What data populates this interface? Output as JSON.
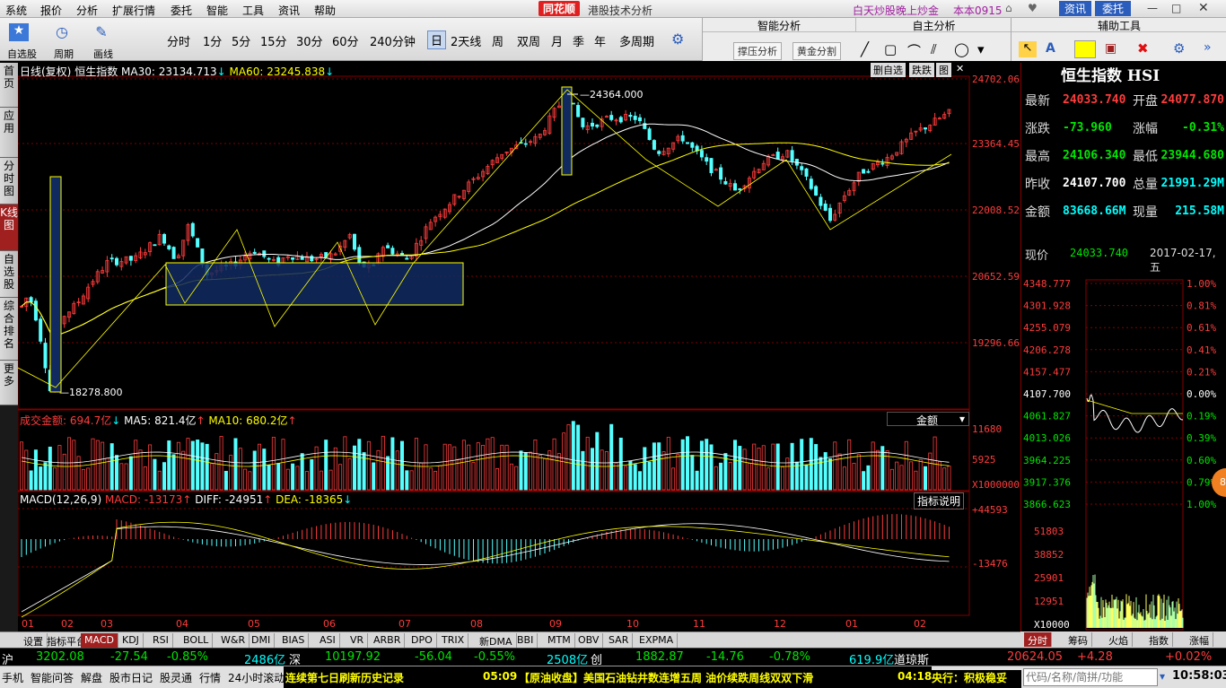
{
  "menu": [
    "系统",
    "报价",
    "分析",
    "扩展行情",
    "委托",
    "智能",
    "工具",
    "资讯",
    "帮助"
  ],
  "brand": "同花顺",
  "window_title": "港股技术分析",
  "ad_text": "白天炒股晚上炒金",
  "version": "本本0915",
  "news_btn": "资讯",
  "trade_btn": "委托",
  "toolbar": {
    "small_labels": [
      "自选股",
      "周期",
      "画线"
    ],
    "periods": [
      "分时",
      "1分",
      "5分",
      "15分",
      "30分",
      "60分",
      "240分钟",
      "日",
      "2天线",
      "周",
      "双周",
      "月",
      "季",
      "年",
      "多周期"
    ],
    "active_period": "日",
    "smart_title": "智能分析",
    "smart_btns": [
      "撑压分析",
      "黄金分割"
    ],
    "self_title": "自主分析",
    "aux_title": "辅助工具"
  },
  "sidebar_tabs": [
    "首页",
    "应用",
    "分时图",
    "K线图",
    "自选股",
    "综合排名",
    "更多"
  ],
  "main": {
    "header": {
      "type": "日线(复权)",
      "name": "恒生指数",
      "ma30": "MA30: 23134.713",
      "ma60": "MA60: 23245.838"
    },
    "top_btns": [
      "删自选",
      "跌跌",
      "图"
    ],
    "price_axis": [
      "24702.06",
      "23364.45",
      "22008.52",
      "20652.59",
      "19296.66"
    ],
    "high_label": "24364.000",
    "low_label": "18278.800",
    "vol_header": {
      "label": "成交金额: 694.7亿",
      "ma5": "MA5: 821.4亿",
      "ma10": "MA10: 680.2亿"
    },
    "vol_select": "金额",
    "vol_axis": [
      "11680",
      "5925",
      "X1000000"
    ],
    "macd_header": {
      "label": "MACD(12,26,9)",
      "macd": "MACD: -13173",
      "diff": "DIFF: -24951",
      "dea": "DEA: -18365"
    },
    "macd_btn": "指标说明",
    "macd_axis": [
      "+44593",
      "-13476"
    ],
    "months": [
      "01",
      "02",
      "03",
      "04",
      "05",
      "06",
      "07",
      "08",
      "09",
      "10",
      "11",
      "12",
      "01",
      "02"
    ]
  },
  "indicator_tabs": [
    "设置",
    "指标平台",
    "MACD",
    "KDJ",
    "RSI",
    "BOLL",
    "W&R",
    "DMI",
    "BIAS",
    "ASI",
    "VR",
    "ARBR",
    "DPO",
    "TRIX",
    "新DMA",
    "BBI",
    "MTM",
    "OBV",
    "SAR",
    "EXPMA"
  ],
  "active_indicator": "MACD",
  "quote": {
    "title": "恒生指数 HSI",
    "rows": [
      {
        "l1": "最新",
        "v1": "24033.740",
        "c1": "red",
        "l2": "开盘",
        "v2": "24077.870",
        "c2": "red"
      },
      {
        "l1": "涨跌",
        "v1": "-73.960",
        "c1": "green",
        "l2": "涨幅",
        "v2": "-0.31%",
        "c2": "green"
      },
      {
        "l1": "最高",
        "v1": "24106.340",
        "c1": "green",
        "l2": "最低",
        "v2": "23944.680",
        "c2": "green"
      },
      {
        "l1": "昨收",
        "v1": "24107.700",
        "c1": "white",
        "l2": "总量",
        "v2": "21991.29M",
        "c2": "cyan"
      },
      {
        "l1": "金额",
        "v1": "83668.66M",
        "c1": "cyan",
        "l2": "现量",
        "v2": "215.58M",
        "c2": "cyan"
      }
    ],
    "now_label": "现价",
    "now_value": "24033.740",
    "date": "2017-02-17,五",
    "intraday_left": [
      "4348.777",
      "4301.928",
      "4255.079",
      "4206.278",
      "4157.477",
      "4107.700",
      "4061.827",
      "4013.026",
      "3964.225",
      "3917.376",
      "3866.623"
    ],
    "intraday_right": [
      "1.00%",
      "0.81%",
      "0.61%",
      "0.41%",
      "0.21%",
      "0.00%",
      "0.19%",
      "0.39%",
      "0.60%",
      "0.79%",
      "1.00%"
    ],
    "vol_left": [
      "51803",
      "38852",
      "25901",
      "12951",
      "X10000"
    ],
    "badge": "81"
  },
  "right_tabs": [
    "分时",
    "筹码",
    "火焰",
    "指数",
    "涨幅"
  ],
  "ticker": {
    "a_label": "沪",
    "a_val": "3202.08",
    "a_chg": "-27.54",
    "a_pct": "-0.85%",
    "a_amt": "2486亿",
    "b_label": "深",
    "b_val": "10197.92",
    "b_chg": "-56.04",
    "b_pct": "-0.55%",
    "b_amt": "2508亿",
    "c_label": "创",
    "c_val": "1882.87",
    "c_chg": "-14.76",
    "c_pct": "-0.78%",
    "c_amt": "619.9亿",
    "d_label": "道琼斯",
    "d_val": "20624.05",
    "d_chg": "+4.28",
    "d_pct": "+0.02%"
  },
  "status": {
    "items": [
      "手机",
      "智能问答",
      "解盘",
      "股市日记",
      "股灵通",
      "行情",
      "24小时滚动"
    ],
    "news1": "连续第七日刷新历史记录",
    "news2_time": "05:09",
    "news2": "【原油收盘】美国石油钻井数连增五周 油价续跌周线双双下滑",
    "news3_time": "04:18",
    "news3": "央行：积极稳妥",
    "search_placeholder": "代码/名称/简拼/功能",
    "clock": "10:58:03"
  },
  "colors": {
    "up": "#ff3c3c",
    "down": "#54ffff",
    "ma_yellow": "#ffff00",
    "ma_white": "#ffffff",
    "grid": "#800000",
    "box": "#102a60"
  }
}
